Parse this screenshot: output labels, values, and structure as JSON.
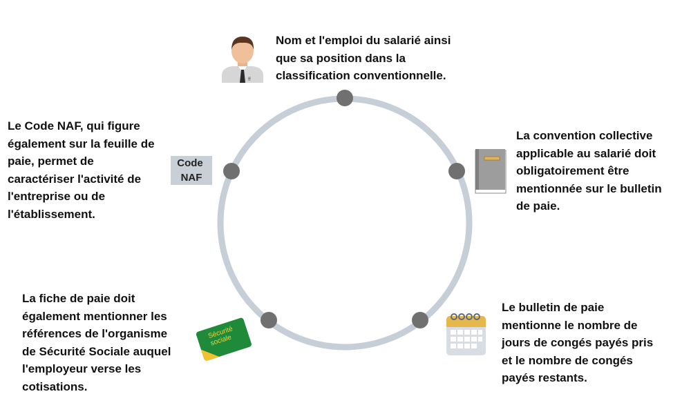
{
  "diagram": {
    "colors": {
      "ring": "#c6ced8",
      "node": "#707070",
      "naf_box": "#c9cfd7",
      "book": "#9d9d9d",
      "card": "#1e8a3a",
      "calendar": "#d8dde3",
      "calendar_header": "#e6b84c"
    },
    "items": [
      {
        "id": "employee",
        "icon": "person-icon",
        "text": "Nom et l'emploi du salarié ainsi\nque sa position dans la\nclassification conventionnelle."
      },
      {
        "id": "convention",
        "icon": "book-icon",
        "text": "La convention collective\napplicable au salarié doit\nobligatoirement être\nmentionnée sur le bulletin\nde paie."
      },
      {
        "id": "conges",
        "icon": "calendar-icon",
        "text": "Le bulletin de paie\nmentionne le nombre de\njours de congés payés pris\net le nombre de congés\npayés restants."
      },
      {
        "id": "secu",
        "icon": "securite-sociale-card-icon",
        "text": "La fiche de paie doit\négalement mentionner les\nréférences de l'organisme\nde Sécurité Sociale auquel\nl'employeur verse les\ncotisations."
      },
      {
        "id": "naf",
        "icon": "code-naf-icon",
        "text": "Le Code NAF, qui figure\négalement sur la feuille de\npaie, permet de\ncaractériser l'activité de\nl'entreprise ou de\nl'établissement."
      }
    ],
    "naf_icon_lines": [
      "Code",
      "NAF"
    ],
    "card_icon_lines": [
      "Sécurité",
      "sociale"
    ]
  }
}
